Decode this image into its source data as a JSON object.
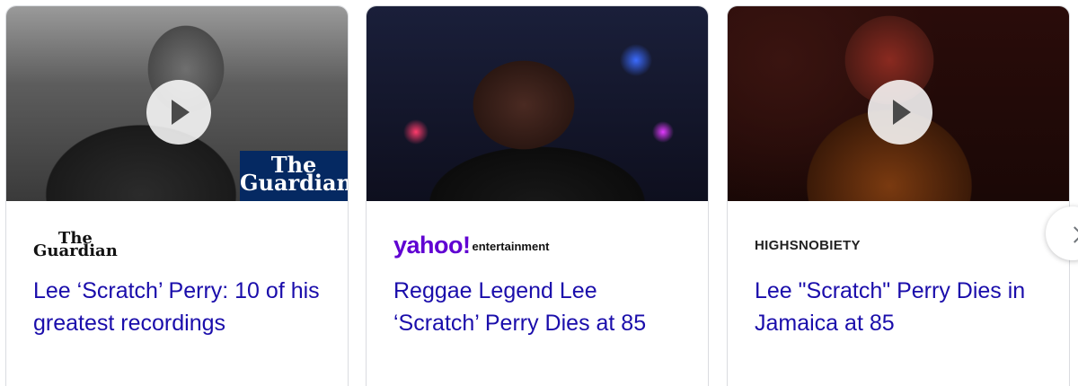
{
  "cards": [
    {
      "source_name": "The Guardian",
      "source_logo_line1": "The",
      "source_logo_line2": "Guardian",
      "thumbnail_overlay_line1": "The",
      "thumbnail_overlay_line2": "Guardian",
      "has_video": true,
      "headline": "Lee ‘Scratch’ Perry: 10 of his greatest recordings"
    },
    {
      "source_name": "yahoo! entertainment",
      "source_logo_main": "yahoo!",
      "source_logo_sub": "entertainment",
      "has_video": false,
      "headline": "Reggae Legend Lee ‘Scratch’ Perry Dies at 85"
    },
    {
      "source_name": "HIGHSNOBIETY",
      "source_logo": "HIGHSNOBIETY",
      "has_video": true,
      "headline": "Lee \"Scratch\" Perry Dies in Jamaica at 85"
    }
  ],
  "icons": {
    "play": "play-icon",
    "next": "chevron-right-icon"
  },
  "colors": {
    "headline_link": "#1a0dab",
    "guardian_blue": "#052962",
    "yahoo_purple": "#6001d2",
    "card_border": "#dadce0"
  }
}
